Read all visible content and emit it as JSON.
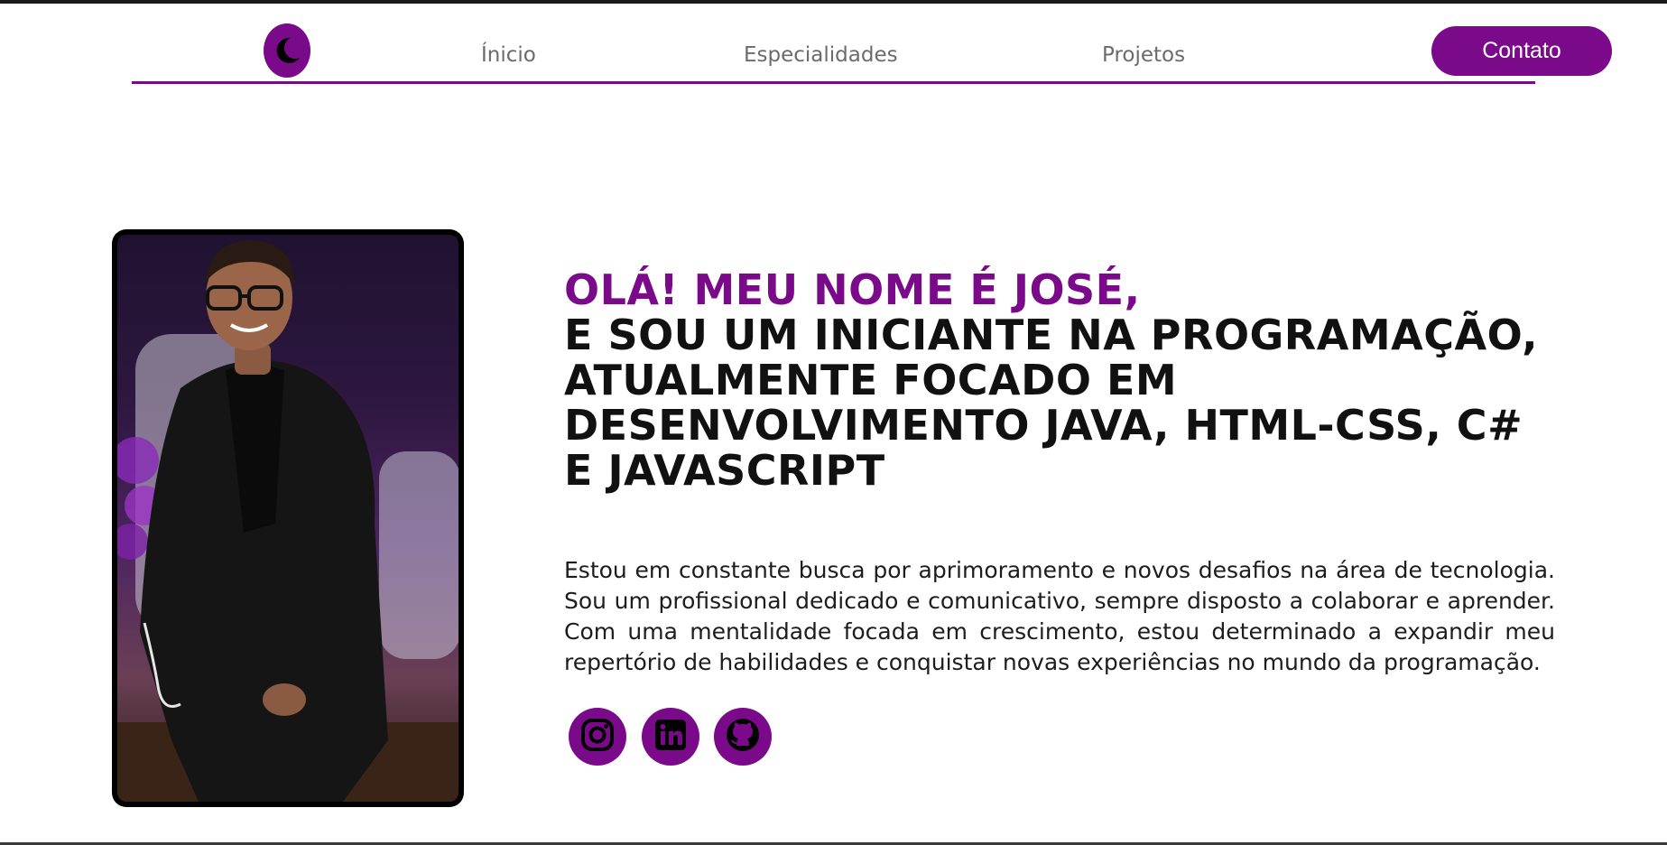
{
  "nav": {
    "links": [
      "Ínicio",
      "Especialidades",
      "Projetos"
    ],
    "cta_label": "Contato"
  },
  "hero": {
    "greeting": "OLÁ! MEU NOME É JOSÉ,",
    "heading_lines": [
      "E SOU UM INICIANTE NA PROGRAMAÇÃO,",
      "ATUALMENTE FOCADO EM",
      "DESENVOLVIMENTO JAVA, HTML-CSS, C#",
      "E JAVASCRIPT"
    ],
    "bio": "Estou em constante busca por aprimoramento e novos desafios na área de tecnologia. Sou um profissional dedicado e comunicativo, sempre disposto a colaborar e aprender. Com uma mentalidade focada em crescimento, estou determinado a expandir meu repertório de habilidades e conquistar novas experiências no mundo da programação."
  },
  "social": {
    "icons": [
      "instagram-icon",
      "linkedin-icon",
      "github-icon"
    ]
  },
  "colors": {
    "accent": "#7a0a8a",
    "heading": "#111111",
    "nav_text": "#6b6b6b"
  }
}
